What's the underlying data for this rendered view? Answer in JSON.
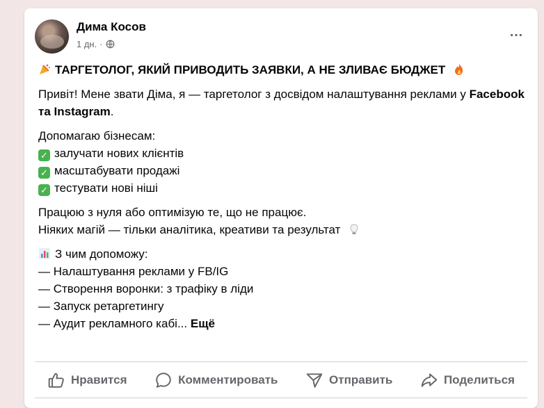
{
  "post": {
    "author": "Дима Косов",
    "time": "1 дн.",
    "separator": "·",
    "more_icon": "…",
    "headline": "ТАРГЕТОЛОГ, ЯКИЙ ПРИВОДИТЬ ЗАЯВКИ, А НЕ ЗЛИВАЄ БЮДЖЕТ",
    "intro_start": "Привіт! Мене звати Діма, я — таргетолог з досвідом налаштування реклами у ",
    "intro_bold": "Facebook та Instagram",
    "intro_end": ".",
    "help_title": "Допомагаю бізнесам:",
    "help_items": [
      "залучати нових клієнтів",
      "масштабувати продажі",
      "тестувати нові ніші"
    ],
    "para_line1": "Працюю з нуля або оптимізую те, що не працює.",
    "para_line2": "Ніяких магій — тільки аналітика, креативи та результат",
    "services_title": "З чим допоможу:",
    "services": [
      "— Налаштування реклами у FB/IG",
      "— Створення воронки: з трафіку в ліди",
      "— Запуск ретаргетингу"
    ],
    "last_line": "— Аудит рекламного кабі...",
    "see_more": "Ещё"
  },
  "actions": {
    "like": "Нравится",
    "comment": "Комментировать",
    "send": "Отправить",
    "share": "Поделиться"
  },
  "colors": {
    "secondary_text": "#65676b",
    "check_green": "#48b24f"
  },
  "icons": [
    "party-popper-icon",
    "fire-icon",
    "check-icon",
    "bar-chart-icon",
    "light-bulb-icon",
    "globe-icon",
    "like-icon",
    "comment-icon",
    "send-icon",
    "share-icon"
  ]
}
